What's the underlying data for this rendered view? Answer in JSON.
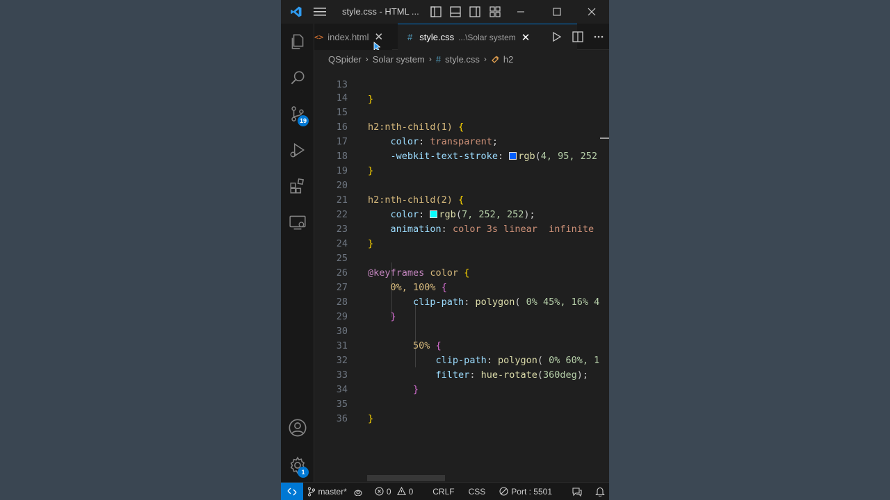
{
  "window": {
    "title": "style.css - HTML ..."
  },
  "activity_bar": {
    "source_control_badge": "19",
    "settings_badge": "1"
  },
  "tabs": [
    {
      "label": "index.html",
      "icon": "html-file-icon",
      "active": false
    },
    {
      "label": "style.css",
      "path_hint": "...\\Solar system",
      "icon": "css-file-icon",
      "active": true
    }
  ],
  "tab_icons": {
    "html": "<>",
    "css": "#"
  },
  "breadcrumbs": [
    "QSpider",
    "Solar system",
    "style.css",
    "h2"
  ],
  "breadcrumb_css_icon": "#",
  "code": {
    "line_numbers": [
      "13",
      "14",
      "15",
      "16",
      "17",
      "18",
      "19",
      "20",
      "21",
      "22",
      "23",
      "24",
      "25",
      "26",
      "27",
      "28",
      "29",
      "30",
      "31",
      "32",
      "33",
      "34",
      "35",
      "36"
    ],
    "l13": "}",
    "l15_sel": "h2:nth-child(1)",
    "l15_brace": "{",
    "l16_prop": "color",
    "l16_val": "transparent",
    "l17_prop": "-webkit-text-stroke",
    "l17_fn": "rgb",
    "l17_args": "4, 95, 252",
    "l17_swatch": "#045ffc",
    "l18": "}",
    "l20_sel": "h2:nth-child(2)",
    "l20_brace": "{",
    "l21_prop": "color",
    "l21_fn": "rgb",
    "l21_args": "7, 252, 252",
    "l21_swatch": "#07fcfc",
    "l22_prop": "animation",
    "l22_val": "color 3s linear  infinite",
    "l23": "}",
    "l25_at": "@keyframes",
    "l25_name": "color",
    "l25_brace": "{",
    "l26_sel": "0%, 100%",
    "l26_brace": "{",
    "l27_prop": "clip-path",
    "l27_fn": "polygon",
    "l27_args": " 0% 45%, 16% 4",
    "l28": "}",
    "l30_sel": "50%",
    "l30_brace": "{",
    "l31_prop": "clip-path",
    "l31_fn": "polygon",
    "l31_args": " 0% 60%, 1",
    "l32_prop": "filter",
    "l32_fn": "hue-rotate",
    "l32_args": "360deg",
    "l33": "}",
    "l35": "}"
  },
  "status_bar": {
    "branch": "master*",
    "errors": "0",
    "warnings": "0",
    "eol": "CRLF",
    "language": "CSS",
    "port": "Port : 5501"
  },
  "colors": {
    "accent": "#0078d4",
    "editor_bg": "#1f1f1f"
  }
}
